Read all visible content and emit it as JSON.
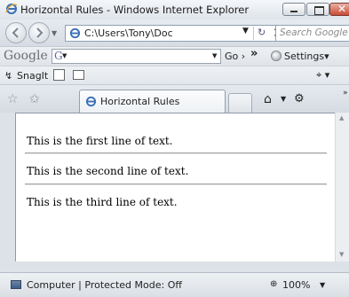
{
  "window": {
    "title": "Horizontal Rules - Windows Internet Explorer"
  },
  "address_bar": {
    "url": "C:\\Users\\Tony\\Doc",
    "search_placeholder": "Search Google"
  },
  "google_toolbar": {
    "logo": "Google",
    "go_label": "Go",
    "settings_label": "Settings"
  },
  "snagit_toolbar": {
    "label": "SnagIt"
  },
  "tabs": [
    {
      "label": "Horizontal Rules",
      "active": true
    }
  ],
  "document": {
    "lines": [
      "This is the first line of text.",
      "This is the second line of text.",
      "This is the third line of text."
    ]
  },
  "status_bar": {
    "zone": "Computer | Protected Mode: Off",
    "zoom": "100%"
  },
  "colors": {
    "chrome": "#dde2e8",
    "close_button": "#c84a35",
    "content_background": "#ffffff"
  }
}
